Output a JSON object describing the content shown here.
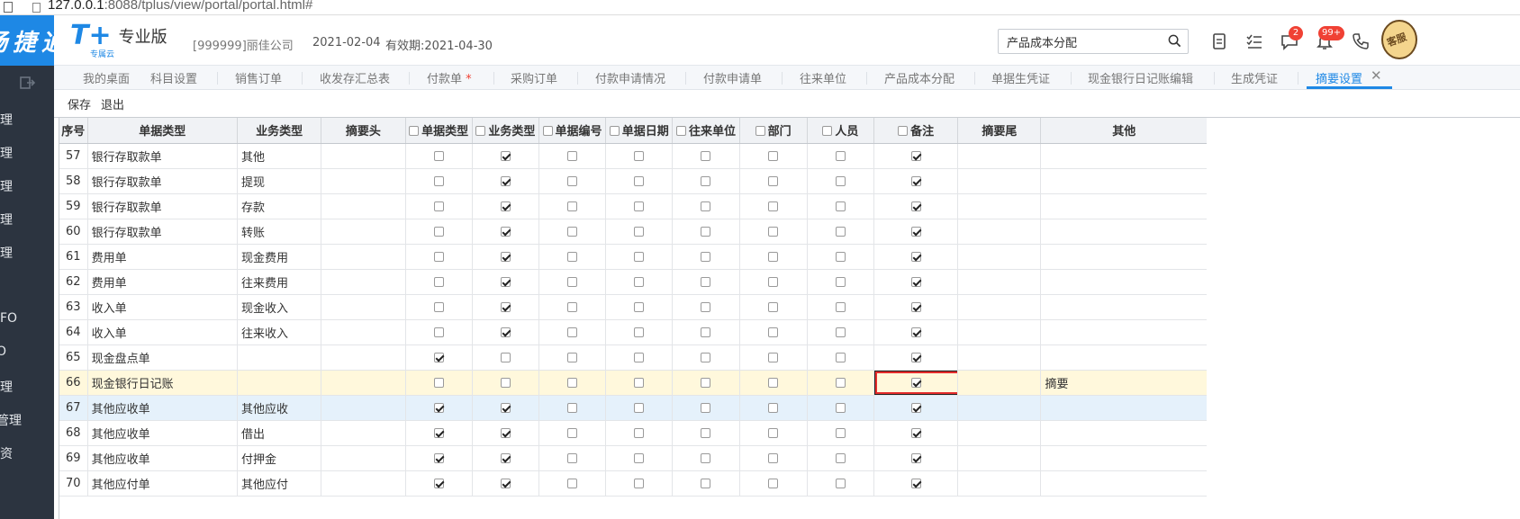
{
  "browser": {
    "url_host": "127.0.0.1",
    "url_rest": ":8088/tplus/view/portal/portal.html#"
  },
  "sidebar": {
    "brand": "畅捷通",
    "items": [
      "理",
      "理",
      "理",
      "理",
      "理",
      "FO",
      "O",
      "理",
      "管理",
      "资"
    ]
  },
  "header": {
    "logo": "T+",
    "logo_sub": "专属云",
    "edition": "专业版",
    "company": "[999999]丽佳公司",
    "date": "2021-02-04",
    "valid": "有效期:2021-04-30",
    "search_value": "产品成本分配",
    "badge_messages": "2",
    "badge_notifications": "99+",
    "avatar_text": "客服"
  },
  "tabs": [
    {
      "label": "我的桌面"
    },
    {
      "label": "科目设置"
    },
    {
      "label": "销售订单"
    },
    {
      "label": "收发存汇总表"
    },
    {
      "label": "付款单",
      "dirty": "*"
    },
    {
      "label": "采购订单"
    },
    {
      "label": "付款申请情况"
    },
    {
      "label": "付款申请单"
    },
    {
      "label": "往来单位"
    },
    {
      "label": "产品成本分配"
    },
    {
      "label": "单据生凭证"
    },
    {
      "label": "现金银行日记账编辑"
    },
    {
      "label": "生成凭证"
    },
    {
      "label": "摘要设置",
      "active": true
    }
  ],
  "toolbar": {
    "save": "保存",
    "exit": "退出"
  },
  "colors": {
    "accent": "#1e88e5",
    "highlight_row": "#fff8dc",
    "selected_row": "#e5f1fb",
    "focus": "#e52c2c"
  },
  "grid": {
    "headers": {
      "no": "序号",
      "doc_type": "单据类型",
      "biz_type": "业务类型",
      "head": "摘要头",
      "c_doc_type": "单据类型",
      "c_biz_type": "业务类型",
      "c_doc_no": "单据编号",
      "c_doc_date": "单据日期",
      "c_partner": "往来单位",
      "c_dept": "部门",
      "c_staff": "人员",
      "c_memo": "备注",
      "tail": "摘要尾",
      "other": "其他"
    },
    "rows": [
      {
        "no": "57",
        "doc_type": "银行存取款单",
        "biz_type": "其他",
        "checks": [
          0,
          1,
          0,
          0,
          0,
          0,
          0,
          1
        ],
        "other": ""
      },
      {
        "no": "58",
        "doc_type": "银行存取款单",
        "biz_type": "提现",
        "checks": [
          0,
          1,
          0,
          0,
          0,
          0,
          0,
          1
        ],
        "other": ""
      },
      {
        "no": "59",
        "doc_type": "银行存取款单",
        "biz_type": "存款",
        "checks": [
          0,
          1,
          0,
          0,
          0,
          0,
          0,
          1
        ],
        "other": ""
      },
      {
        "no": "60",
        "doc_type": "银行存取款单",
        "biz_type": "转账",
        "checks": [
          0,
          1,
          0,
          0,
          0,
          0,
          0,
          1
        ],
        "other": ""
      },
      {
        "no": "61",
        "doc_type": "费用单",
        "biz_type": "现金费用",
        "checks": [
          0,
          1,
          0,
          0,
          0,
          0,
          0,
          1
        ],
        "other": ""
      },
      {
        "no": "62",
        "doc_type": "费用单",
        "biz_type": "往来费用",
        "checks": [
          0,
          1,
          0,
          0,
          0,
          0,
          0,
          1
        ],
        "other": ""
      },
      {
        "no": "63",
        "doc_type": "收入单",
        "biz_type": "现金收入",
        "checks": [
          0,
          1,
          0,
          0,
          0,
          0,
          0,
          1
        ],
        "other": ""
      },
      {
        "no": "64",
        "doc_type": "收入单",
        "biz_type": "往来收入",
        "checks": [
          0,
          1,
          0,
          0,
          0,
          0,
          0,
          1
        ],
        "other": ""
      },
      {
        "no": "65",
        "doc_type": "现金盘点单",
        "biz_type": "",
        "checks": [
          1,
          0,
          0,
          0,
          0,
          0,
          0,
          1
        ],
        "other": ""
      },
      {
        "no": "66",
        "doc_type": "现金银行日记账",
        "biz_type": "",
        "checks": [
          0,
          0,
          0,
          0,
          0,
          0,
          0,
          1
        ],
        "other": "摘要",
        "state": "hl",
        "focus_col": 7
      },
      {
        "no": "67",
        "doc_type": "其他应收单",
        "biz_type": "其他应收",
        "checks": [
          1,
          1,
          0,
          0,
          0,
          0,
          0,
          1
        ],
        "other": "",
        "state": "sel"
      },
      {
        "no": "68",
        "doc_type": "其他应收单",
        "biz_type": "借出",
        "checks": [
          1,
          1,
          0,
          0,
          0,
          0,
          0,
          1
        ],
        "other": ""
      },
      {
        "no": "69",
        "doc_type": "其他应收单",
        "biz_type": "付押金",
        "checks": [
          1,
          1,
          0,
          0,
          0,
          0,
          0,
          1
        ],
        "other": ""
      },
      {
        "no": "70",
        "doc_type": "其他应付单",
        "biz_type": "其他应付",
        "checks": [
          1,
          1,
          0,
          0,
          0,
          0,
          0,
          1
        ],
        "other": ""
      }
    ]
  }
}
